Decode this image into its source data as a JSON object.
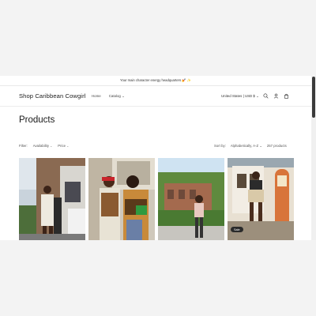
{
  "announcement": {
    "text": "Your main character energy headquarters 💅 ✨"
  },
  "header": {
    "logo": "Shop Caribbean Cowgirl",
    "nav": {
      "home": "Home",
      "catalog": "Catalog ⌄"
    },
    "locale": "United States | USD $ ⌄",
    "icons": [
      "search-icon",
      "account-icon",
      "cart-icon"
    ]
  },
  "collection": {
    "title": "Products"
  },
  "filters": {
    "label": "Filter:",
    "availability": "Availability",
    "price": "Price",
    "sort_label": "Sort by:",
    "sort_value": "Alphabetically, A-Z",
    "product_count": "257 products"
  },
  "products": [
    {
      "badge": ""
    },
    {
      "badge": ""
    },
    {
      "badge": ""
    },
    {
      "badge": "Sale"
    }
  ],
  "colors": {
    "sale_badge": "#2a2a2a",
    "text": "#1a1a1a",
    "background": "#ffffff"
  }
}
